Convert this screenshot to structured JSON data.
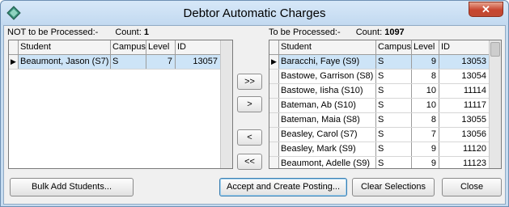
{
  "window": {
    "title": "Debtor Automatic Charges",
    "close_glyph": "✕"
  },
  "left_panel": {
    "label": "NOT to be Processed:-",
    "count_label": "Count:",
    "count": "1",
    "columns": [
      "Student",
      "Campus",
      "Level",
      "ID"
    ],
    "rows": [
      {
        "student": "Beaumont, Jason (S7)",
        "campus": "S",
        "level": "7",
        "id": "13057",
        "selected": true
      }
    ]
  },
  "right_panel": {
    "label": "To be Processed:-",
    "count_label": "Count:",
    "count": "1097",
    "columns": [
      "Student",
      "Campus",
      "Level",
      "ID"
    ],
    "rows": [
      {
        "student": "Baracchi, Faye (S9)",
        "campus": "S",
        "level": "9",
        "id": "13053",
        "selected": true
      },
      {
        "student": "Bastowe, Garrison (S8)",
        "campus": "S",
        "level": "8",
        "id": "13054",
        "selected": false
      },
      {
        "student": "Bastowe, Iisha (S10)",
        "campus": "S",
        "level": "10",
        "id": "11114",
        "selected": false
      },
      {
        "student": "Bateman, Ab (S10)",
        "campus": "S",
        "level": "10",
        "id": "11117",
        "selected": false
      },
      {
        "student": "Bateman, Maia (S8)",
        "campus": "S",
        "level": "8",
        "id": "13055",
        "selected": false
      },
      {
        "student": "Beasley, Carol (S7)",
        "campus": "S",
        "level": "7",
        "id": "13056",
        "selected": false
      },
      {
        "student": "Beasley, Mark (S9)",
        "campus": "S",
        "level": "9",
        "id": "11120",
        "selected": false
      },
      {
        "student": "Beaumont, Adelle (S9)",
        "campus": "S",
        "level": "9",
        "id": "11123",
        "selected": false
      }
    ]
  },
  "transfer_buttons": {
    "move_all_right": ">>",
    "move_right": ">",
    "move_left": "<",
    "move_all_left": "<<"
  },
  "footer": {
    "bulk_add": "Bulk Add Students...",
    "accept": "Accept and Create Posting...",
    "clear": "Clear Selections",
    "close": "Close"
  },
  "icons": {
    "app": "diamond-app-icon",
    "row_indicator": "current-row-arrow-icon"
  },
  "colors": {
    "titlebar": "#c6dcf0",
    "selected_row": "#cde4f7",
    "close_button": "#c7452f"
  }
}
